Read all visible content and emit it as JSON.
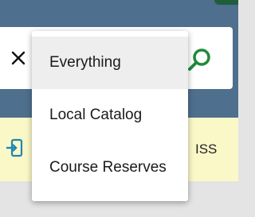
{
  "colors": {
    "header": "#4f6f8e",
    "accent_green": "#1f8a3a",
    "notice_bg": "#fbf8c8",
    "icon_blue": "#1e88b5"
  },
  "search": {
    "clear_icon": "close-icon",
    "submit_icon": "search-icon"
  },
  "dropdown": {
    "items": [
      {
        "label": "Everything",
        "selected": true
      },
      {
        "label": "Local Catalog",
        "selected": false
      },
      {
        "label": "Course Reserves",
        "selected": false
      }
    ]
  },
  "notice": {
    "icon": "login-icon",
    "trailing_text": "ISS"
  }
}
